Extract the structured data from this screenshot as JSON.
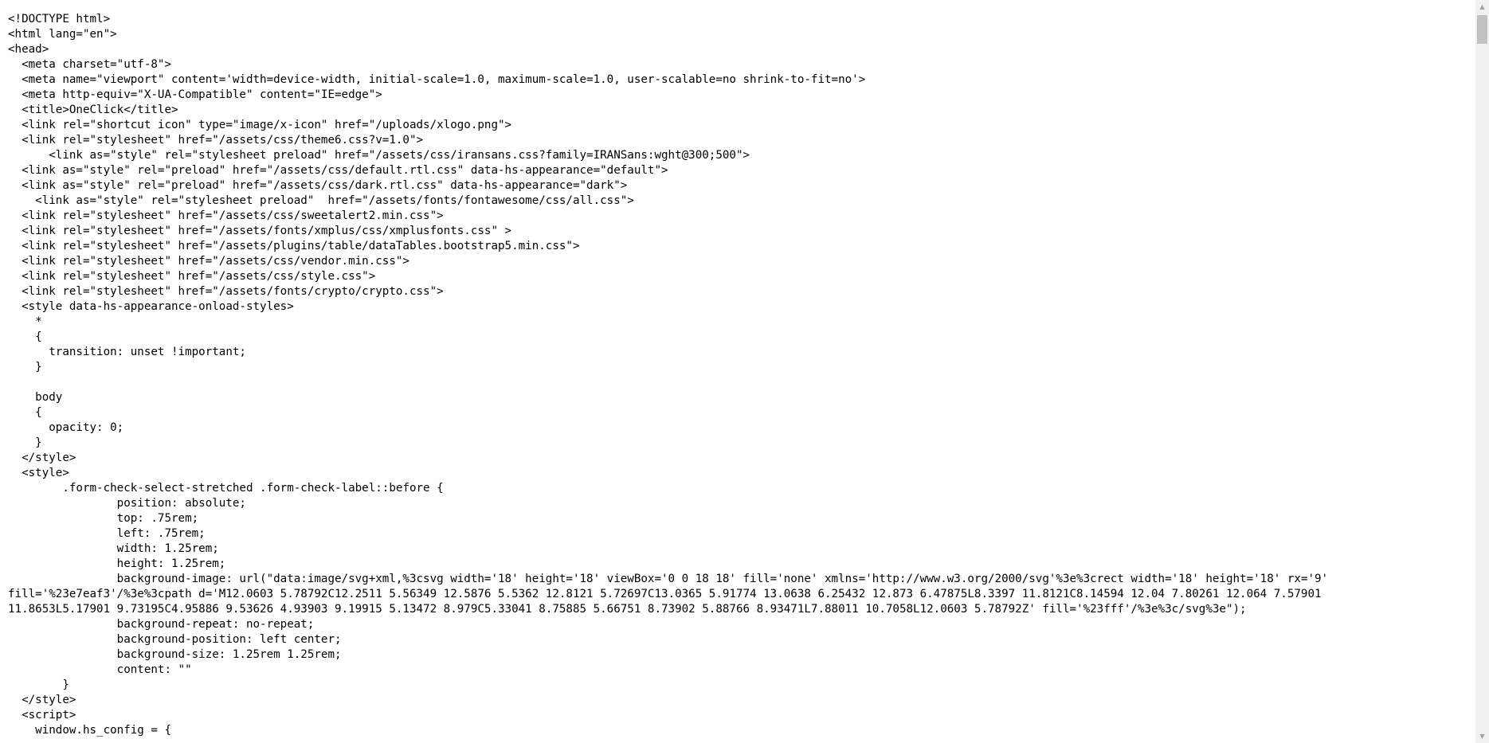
{
  "source": {
    "lines": [
      "<!DOCTYPE html>",
      "<html lang=\"en\">",
      "<head>",
      "  <meta charset=\"utf-8\">",
      "  <meta name=\"viewport\" content='width=device-width, initial-scale=1.0, maximum-scale=1.0, user-scalable=no shrink-to-fit=no'>",
      "  <meta http-equiv=\"X-UA-Compatible\" content=\"IE=edge\">",
      "  <title>OneClick</title>",
      "  <link rel=\"shortcut icon\" type=\"image/x-icon\" href=\"/uploads/xlogo.png\">",
      "  <link rel=\"stylesheet\" href=\"/assets/css/theme6.css?v=1.0\">",
      "      <link as=\"style\" rel=\"stylesheet preload\" href=\"/assets/css/iransans.css?family=IRANSans:wght@300;500\">",
      "  <link as=\"style\" rel=\"preload\" href=\"/assets/css/default.rtl.css\" data-hs-appearance=\"default\">",
      "  <link as=\"style\" rel=\"preload\" href=\"/assets/css/dark.rtl.css\" data-hs-appearance=\"dark\">",
      "    <link as=\"style\" rel=\"stylesheet preload\"  href=\"/assets/fonts/fontawesome/css/all.css\">",
      "  <link rel=\"stylesheet\" href=\"/assets/css/sweetalert2.min.css\">",
      "  <link rel=\"stylesheet\" href=\"/assets/fonts/xmplus/css/xmplusfonts.css\" >",
      "  <link rel=\"stylesheet\" href=\"/assets/plugins/table/dataTables.bootstrap5.min.css\">",
      "  <link rel=\"stylesheet\" href=\"/assets/css/vendor.min.css\">",
      "  <link rel=\"stylesheet\" href=\"/assets/css/style.css\">",
      "  <link rel=\"stylesheet\" href=\"/assets/fonts/crypto/crypto.css\">",
      "  <style data-hs-appearance-onload-styles>",
      "    *",
      "    {",
      "      transition: unset !important;",
      "    }",
      "",
      "    body",
      "    {",
      "      opacity: 0;",
      "    }",
      "  </style>",
      "  <style>",
      "        .form-check-select-stretched .form-check-label::before {",
      "                position: absolute;",
      "                top: .75rem;",
      "                left: .75rem;",
      "                width: 1.25rem;",
      "                height: 1.25rem;",
      "                background-image: url(\"data:image/svg+xml,%3csvg width='18' height='18' viewBox='0 0 18 18' fill='none' xmlns='http://www.w3.org/2000/svg'%3e%3crect width='18' height='18' rx='9'",
      "fill='%23e7eaf3'/%3e%3cpath d='M12.0603 5.78792C12.2511 5.56349 12.5876 5.5362 12.8121 5.72697C13.0365 5.91774 13.0638 6.25432 12.873 6.47875L8.3397 11.8121C8.14594 12.04 7.80261 12.064 7.57901",
      "11.8653L5.17901 9.73195C4.95886 9.53626 4.93903 9.19915 5.13472 8.979C5.33041 8.75885 5.66751 8.73902 5.88766 8.93471L7.88011 10.7058L12.0603 5.78792Z' fill='%23fff'/%3e%3c/svg%3e\");",
      "                background-repeat: no-repeat;",
      "                background-position: left center;",
      "                background-size: 1.25rem 1.25rem;",
      "                content: \"\"",
      "        }",
      "  </style>",
      "  <script>",
      "    window.hs_config = {"
    ]
  },
  "scrollbar": {
    "up_arrow": "▲",
    "down_arrow": "▼"
  }
}
